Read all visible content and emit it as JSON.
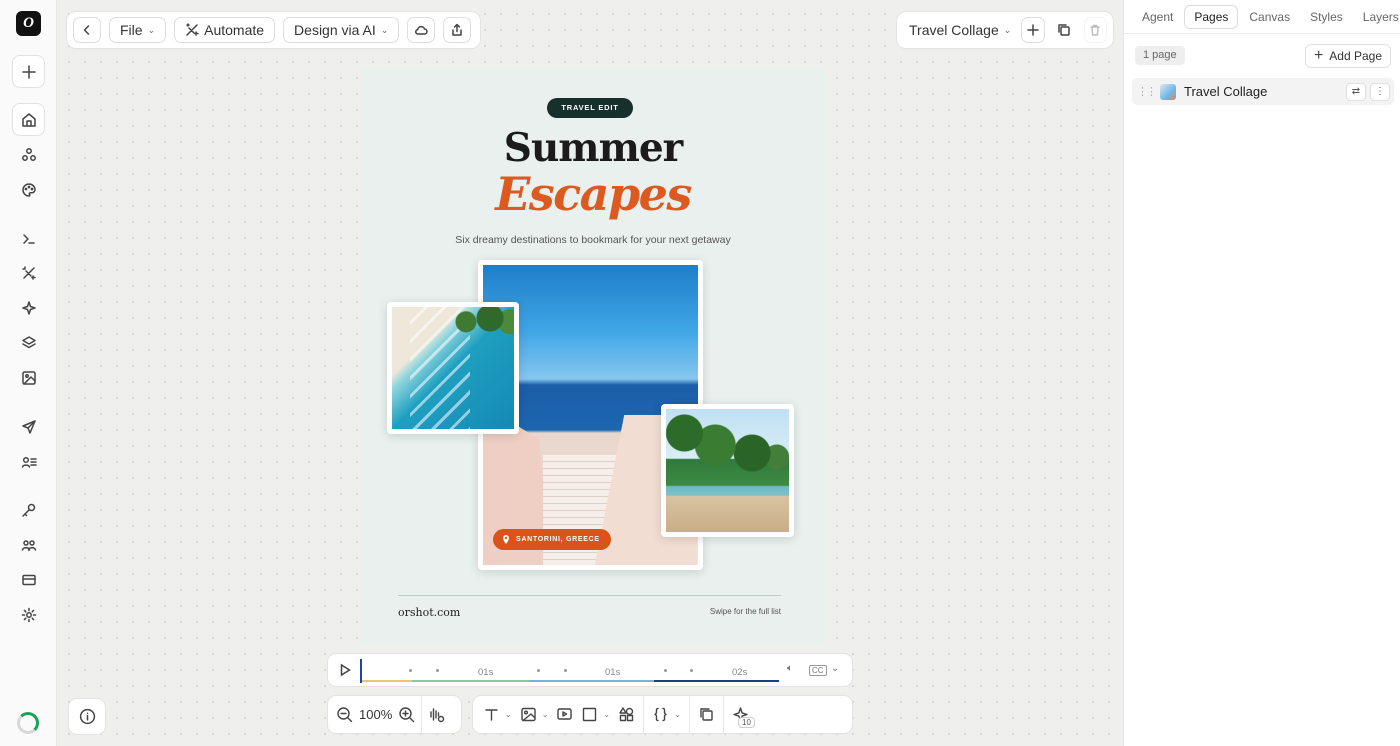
{
  "app": {
    "logo_letter": "O"
  },
  "toolbar": {
    "file_label": "File",
    "automate_label": "Automate",
    "design_ai_label": "Design via AI",
    "template_name": "Travel Collage"
  },
  "artboard": {
    "badge": "TRAVEL EDIT",
    "title_line1": "Summer",
    "title_line2": "Escapes",
    "subtitle": "Six dreamy destinations to bookmark for your next getaway",
    "location_label": "SANTORINI, GREECE",
    "footer_left": "orshot.com",
    "footer_right": "Swipe for the full list",
    "accent_color": "#dc5a1f",
    "badge_color": "#17302c"
  },
  "timeline": {
    "ticks": [
      "01s",
      "01s",
      "02s"
    ]
  },
  "zoom": {
    "level": "100%"
  },
  "tools": {
    "variables_count": "10"
  },
  "panel": {
    "tabs": [
      "Agent",
      "Pages",
      "Canvas",
      "Styles",
      "Layers"
    ],
    "active_tab": "Pages",
    "page_count": "1 page",
    "add_page_label": "Add Page",
    "pages": [
      {
        "name": "Travel Collage"
      }
    ]
  }
}
